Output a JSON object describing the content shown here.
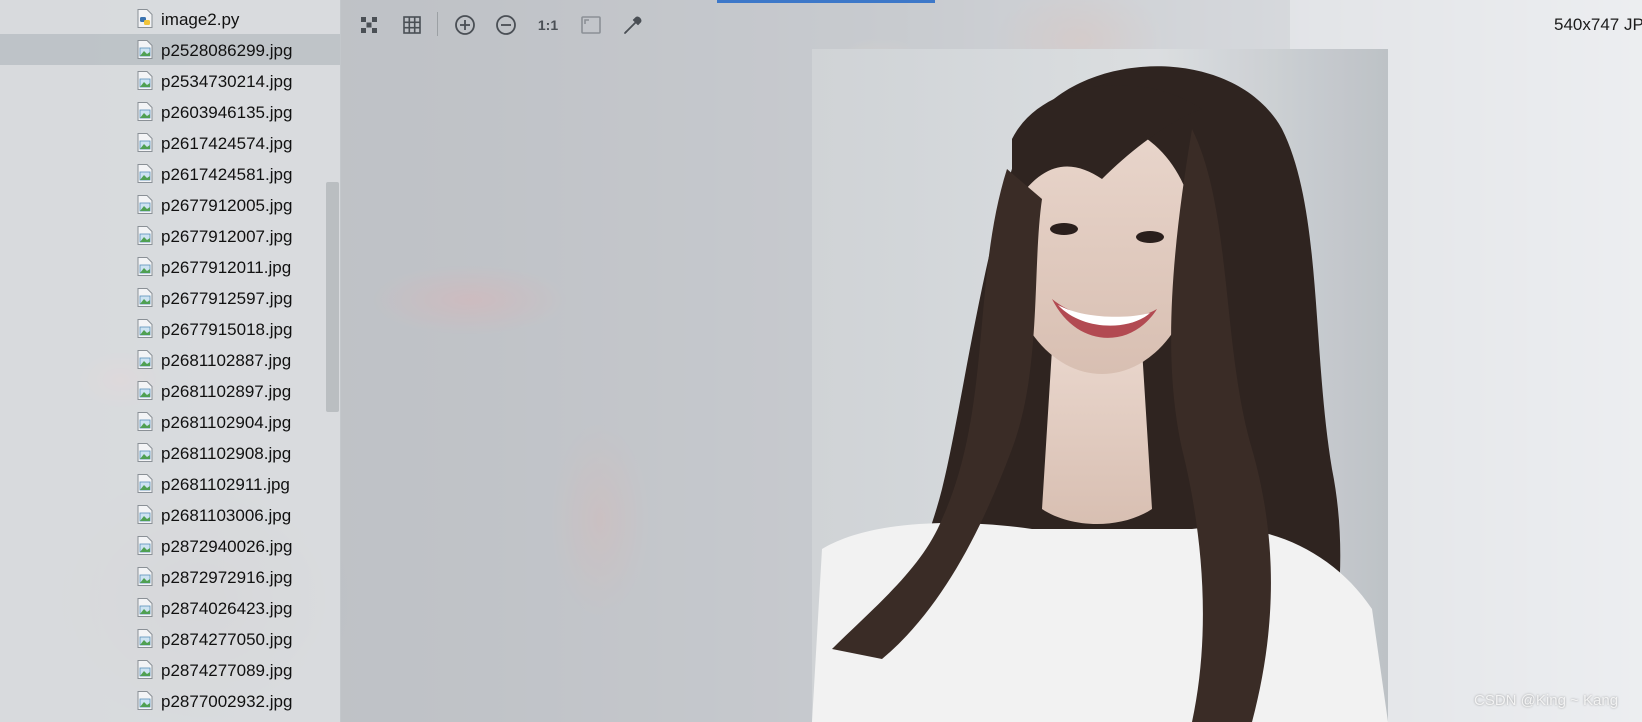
{
  "project_tree": {
    "files": [
      {
        "name": "image2.py",
        "type": "python",
        "selected": false
      },
      {
        "name": "p2528086299.jpg",
        "type": "image",
        "selected": true
      },
      {
        "name": "p2534730214.jpg",
        "type": "image",
        "selected": false
      },
      {
        "name": "p2603946135.jpg",
        "type": "image",
        "selected": false
      },
      {
        "name": "p2617424574.jpg",
        "type": "image",
        "selected": false
      },
      {
        "name": "p2617424581.jpg",
        "type": "image",
        "selected": false
      },
      {
        "name": "p2677912005.jpg",
        "type": "image",
        "selected": false
      },
      {
        "name": "p2677912007.jpg",
        "type": "image",
        "selected": false
      },
      {
        "name": "p2677912011.jpg",
        "type": "image",
        "selected": false
      },
      {
        "name": "p2677912597.jpg",
        "type": "image",
        "selected": false
      },
      {
        "name": "p2677915018.jpg",
        "type": "image",
        "selected": false
      },
      {
        "name": "p2681102887.jpg",
        "type": "image",
        "selected": false
      },
      {
        "name": "p2681102897.jpg",
        "type": "image",
        "selected": false
      },
      {
        "name": "p2681102904.jpg",
        "type": "image",
        "selected": false
      },
      {
        "name": "p2681102908.jpg",
        "type": "image",
        "selected": false
      },
      {
        "name": "p2681102911.jpg",
        "type": "image",
        "selected": false
      },
      {
        "name": "p2681103006.jpg",
        "type": "image",
        "selected": false
      },
      {
        "name": "p2872940026.jpg",
        "type": "image",
        "selected": false
      },
      {
        "name": "p2872972916.jpg",
        "type": "image",
        "selected": false
      },
      {
        "name": "p2874026423.jpg",
        "type": "image",
        "selected": false
      },
      {
        "name": "p2874277050.jpg",
        "type": "image",
        "selected": false
      },
      {
        "name": "p2874277089.jpg",
        "type": "image",
        "selected": false
      },
      {
        "name": "p2877002932.jpg",
        "type": "image",
        "selected": false
      }
    ]
  },
  "toolbar": {
    "buttons": [
      {
        "icon": "chessboard-icon"
      },
      {
        "icon": "grid-icon"
      },
      {
        "icon": "zoom-in-icon"
      },
      {
        "icon": "zoom-out-icon"
      },
      {
        "icon": "actual-size-icon",
        "label": "1:1"
      },
      {
        "icon": "fit-zoom-icon"
      },
      {
        "icon": "color-picker-icon"
      }
    ]
  },
  "image_info": "540x747 JP",
  "watermark": "CSDN @King ~ Kang",
  "colors": {
    "accent": "#3d78c9",
    "selection": "#aab0b6"
  }
}
